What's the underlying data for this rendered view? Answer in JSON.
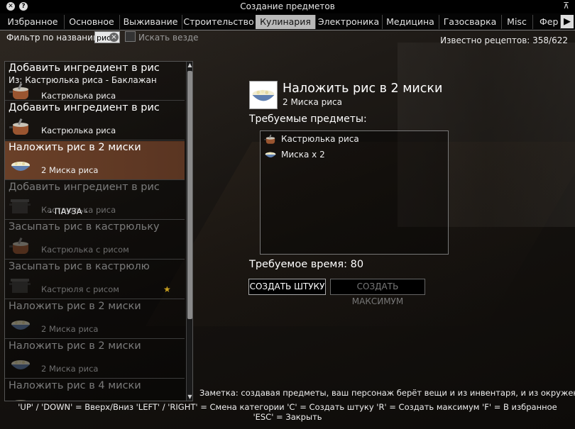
{
  "window": {
    "title": "Создание предметов"
  },
  "tabs": [
    {
      "label": "Избранное"
    },
    {
      "label": "Основное"
    },
    {
      "label": "Выживание"
    },
    {
      "label": "Строительство"
    },
    {
      "label": "Кулинария"
    },
    {
      "label": "Электроника"
    },
    {
      "label": "Медицина"
    },
    {
      "label": "Газосварка"
    },
    {
      "label": "Misc"
    },
    {
      "label": "Фер"
    }
  ],
  "filter": {
    "label": "Фильтр по названию:",
    "value": "рис",
    "search_everywhere_label": "Искать везде"
  },
  "known_recipes": "Известно рецептов: 358/622",
  "recipes": [
    {
      "name": "Добавить ингредиент в рис",
      "sub": "Из: Кастрюлька риса - Баклажан",
      "result": "Кастрюлька риса",
      "icon": "saucepan-icon"
    },
    {
      "name": "Добавить ингредиент в рис",
      "sub": "",
      "result": "Кастрюлька риса",
      "icon": "saucepan-icon"
    },
    {
      "name": "Наложить рис в 2 миски",
      "sub": "",
      "result": "2 Миска риса",
      "icon": "rice-bowl-icon"
    },
    {
      "name": "Добавить ингредиент в рис",
      "sub": "",
      "result": "Кастрюлька риса",
      "overlay": "- ПАУЗА -",
      "icon": "pot-icon"
    },
    {
      "name": "Засыпать рис в кастрюльку",
      "sub": "",
      "result": "Кастрюлька с рисом",
      "icon": "saucepan-icon"
    },
    {
      "name": "Засыпать рис в кастрюлю",
      "sub": "",
      "result": "Кастрюля с рисом",
      "icon": "pot-icon"
    },
    {
      "name": "Наложить рис в 2 миски",
      "sub": "",
      "result": "2 Миска риса",
      "icon": "rice-bowl-icon"
    },
    {
      "name": "Наложить рис в 2 миски",
      "sub": "",
      "result": "2 Миска риса",
      "icon": "rice-bowl-icon"
    },
    {
      "name": "Наложить рис в 4 миски",
      "sub": "",
      "result": "",
      "icon": "rice-bowl-icon"
    }
  ],
  "detail": {
    "title": "Наложить рис в 2 миски",
    "result": "2 Миска риса",
    "required_label": "Требуемые предметы:",
    "required_items": [
      {
        "label": "Кастрюлька риса",
        "icon": "saucepan-icon"
      },
      {
        "label": "Миска x 2",
        "icon": "bowl-icon"
      }
    ],
    "time_label": "Требуемое время: 80",
    "create_one": "СОЗДАТЬ ШТУКУ",
    "create_max": "СОЗДАТЬ МАКСИМУМ"
  },
  "note": "Заметка: создавая предметы, ваш персонаж берёт вещи и из инвентаря, и из окружения.",
  "help": "'UP' / 'DOWN' = Вверх/Вниз  'LEFT' / 'RIGHT' = Смена категории  'C' = Создать штуку  'R' = Создать максимум  'F' = В избранное  'ESC' = Закрыть",
  "colors": {
    "selected_row": "#6a4028",
    "active_tab": "#b9b9b9",
    "favorite_star": "#c9a020"
  }
}
